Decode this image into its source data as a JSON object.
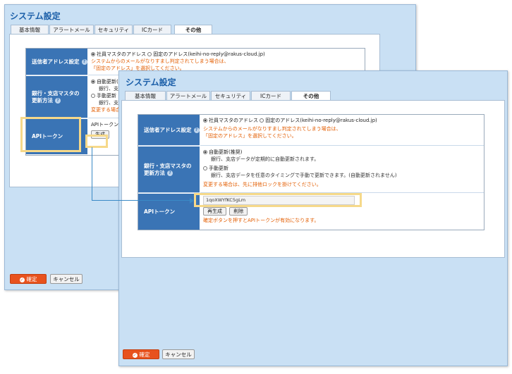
{
  "window_title": "システム設定",
  "tabs": [
    "基本情報",
    "アラートメール",
    "セキュリティ",
    "ICカード",
    "その他"
  ],
  "active_tab": "その他",
  "sender": {
    "label": "送信者アドレス設定",
    "option_default": "社員マスタのアドレス",
    "option_fixed": "固定のアドレス(keihi-no-reply@rakus-cloud.jp)",
    "warning_1": "システムからのメールがなりすまし判定されてしまう場合は、",
    "warning_2": "「固定のアドレス」を選択してください。"
  },
  "bank": {
    "label_1": "銀行・支店マスタの",
    "label_2": "更新方法",
    "auto_label": "自動更新(推奨)",
    "auto_desc": "銀行、支店データが定期的に自動更新されます。",
    "manual_label": "手動更新",
    "manual_desc": "銀行、支店データを任意のタイミングで手動で更新できます。(自動更新されません)",
    "lock_notice": "変更する場合は、先に排他ロックを掛けてください。"
  },
  "back": {
    "auto_label_cut": "自動更新(推",
    "auto_desc_cut": "銀行、支店",
    "manual_desc_cut": "銀行、支店",
    "lock_notice_cut": "変更する場合は",
    "api_placeholder_cut": "APIトークンは",
    "generate_button": "生成"
  },
  "api": {
    "label": "APIトークン",
    "token_prefix": "1qoXWYfKC5gLm",
    "regenerate_button": "再生成",
    "delete_button": "削除",
    "hint": "確定ボタンを押すとAPIトークンが有効になります。"
  },
  "footer": {
    "confirm": "確定",
    "cancel": "キャンセル"
  },
  "colors": {
    "header_blue": "#3a74b5",
    "title_blue": "#1a5ea8",
    "notice_orange": "#e35d00",
    "confirm_orange": "#e8521e",
    "highlight_yellow": "#f6d98a",
    "window_blue": "#c9e0f4"
  }
}
